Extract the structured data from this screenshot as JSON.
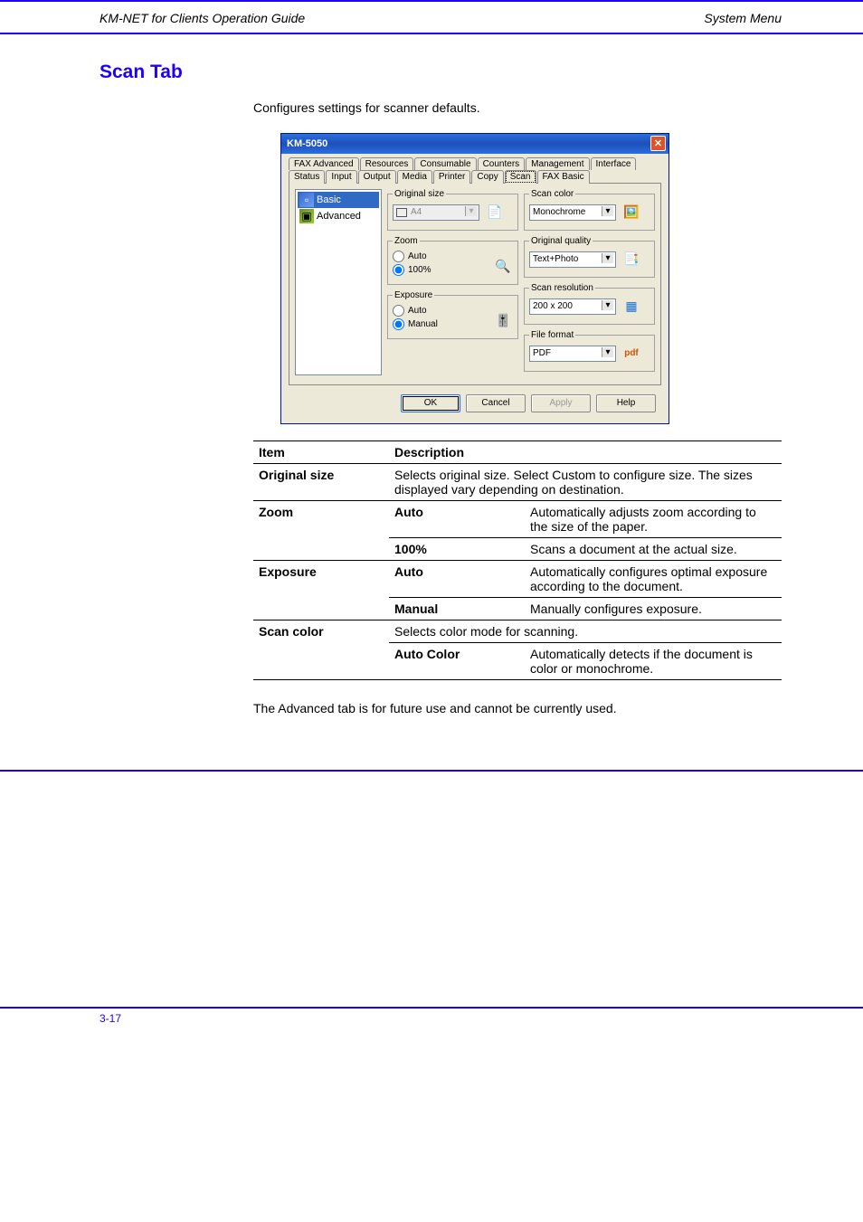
{
  "header": {
    "left": "KM-NET for Clients Operation Guide",
    "right": "System Menu"
  },
  "section": {
    "title": "Scan Tab",
    "intro": "Configures settings for scanner defaults.",
    "note": "The Advanced tab is for future use and cannot be currently used."
  },
  "dialog": {
    "title": "KM-5050",
    "tabs_row1": [
      "FAX Advanced",
      "Resources",
      "Consumable",
      "Counters",
      "Management",
      "Interface"
    ],
    "tabs_row2": [
      "Status",
      "Input",
      "Output",
      "Media",
      "Printer",
      "Copy",
      "Scan",
      "FAX Basic"
    ],
    "active_tab": "Scan",
    "tree": {
      "basic": "Basic",
      "advanced": "Advanced"
    },
    "groups": {
      "original_size": {
        "legend": "Original size",
        "value": "A4"
      },
      "zoom": {
        "legend": "Zoom",
        "auto": "Auto",
        "full": "100%"
      },
      "exposure": {
        "legend": "Exposure",
        "auto": "Auto",
        "manual": "Manual"
      },
      "scan_color": {
        "legend": "Scan color",
        "value": "Monochrome"
      },
      "original_quality": {
        "legend": "Original quality",
        "value": "Text+Photo"
      },
      "scan_resolution": {
        "legend": "Scan resolution",
        "value": "200 x 200"
      },
      "file_format": {
        "legend": "File format",
        "value": "PDF"
      }
    },
    "buttons": {
      "ok": "OK",
      "cancel": "Cancel",
      "apply": "Apply",
      "help": "Help"
    }
  },
  "spec": {
    "headers": [
      "Item",
      "Description"
    ],
    "rows": [
      {
        "item": "Original size",
        "desc": "Selects original size. Select Custom to configure size. The sizes displayed vary depending on destination."
      },
      {
        "item": "Zoom",
        "options": [
          {
            "opt": "Auto",
            "desc": "Automatically adjusts zoom according to the size of the paper."
          },
          {
            "opt": "100%",
            "desc": "Scans a document at the actual size."
          }
        ]
      },
      {
        "item": "Exposure",
        "options": [
          {
            "opt": "Auto",
            "desc": "Automatically configures optimal exposure according to the document."
          },
          {
            "opt": "Manual",
            "desc": "Manually configures exposure."
          }
        ]
      },
      {
        "item": "Scan color",
        "desc_opts": [
          {
            "lead": "Selects color mode for scanning."
          },
          {
            "opt": "Auto Color",
            "desc": "Automatically detects if the document is color or monochrome."
          }
        ]
      }
    ]
  },
  "footer": {
    "page": "3-17",
    "right": ""
  }
}
